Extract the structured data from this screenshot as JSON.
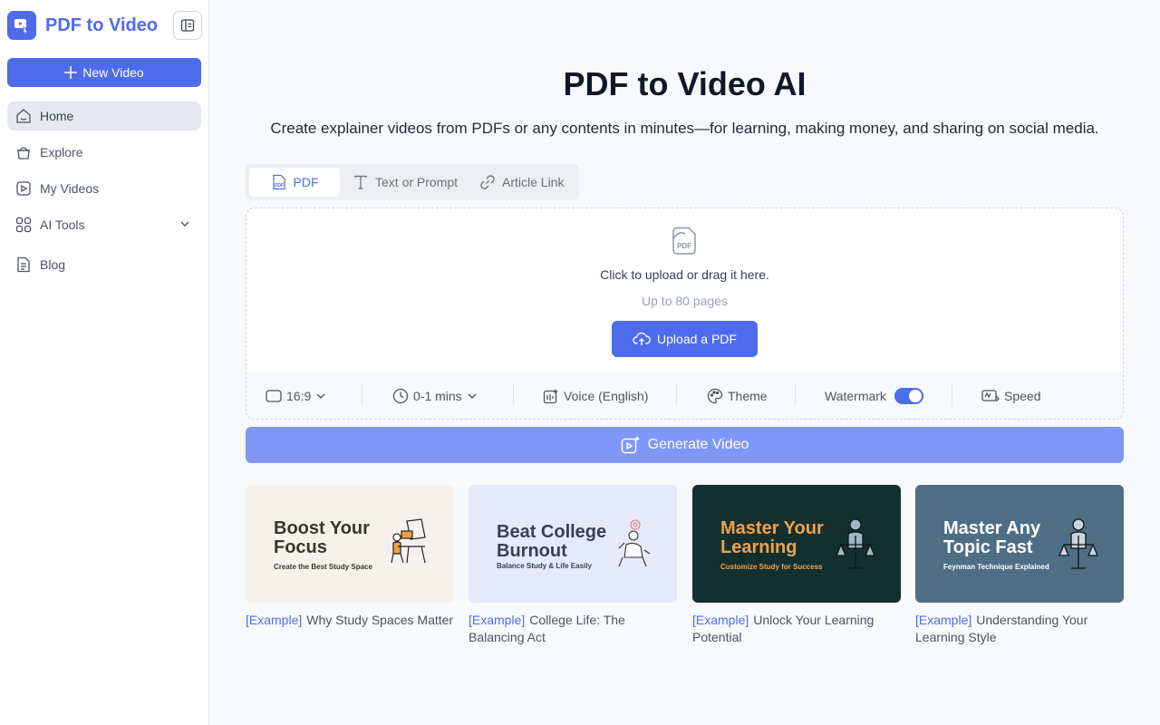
{
  "app": {
    "name": "PDF to Video",
    "brand_color": "#4f6bed"
  },
  "sidebar": {
    "new_video_label": "New Video",
    "items": [
      {
        "label": "Home",
        "icon": "home-icon",
        "active": true
      },
      {
        "label": "Explore",
        "icon": "explore-icon"
      },
      {
        "label": "My Videos",
        "icon": "video-icon"
      },
      {
        "label": "AI Tools",
        "icon": "grid-icon",
        "expandable": true
      },
      {
        "label": "Blog",
        "icon": "document-icon"
      }
    ]
  },
  "main": {
    "title": "PDF to Video AI",
    "subtitle": "Create explainer videos from PDFs or any contents in minutes—for learning, making money, and sharing on social media.",
    "tabs": [
      {
        "label": "PDF",
        "icon": "pdf-icon",
        "active": true
      },
      {
        "label": "Text or Prompt",
        "icon": "text-icon"
      },
      {
        "label": "Article Link",
        "icon": "link-icon"
      }
    ],
    "upload": {
      "text": "Click to upload or drag it here.",
      "sub": "Up to 80 pages",
      "button_label": "Upload a PDF"
    },
    "options": {
      "aspect": "16:9",
      "duration": "0-1 mins",
      "voice": "Voice (English)",
      "theme": "Theme",
      "watermark": "Watermark",
      "watermark_on": true,
      "speed": "Speed"
    },
    "generate_label": "Generate Video",
    "examples": [
      {
        "tag": "[Example]",
        "title": "Why Study Spaces Matter",
        "thumb_title": "Boost Your Focus",
        "thumb_sub": "Create the Best Study Space",
        "bg": "#f5f2ee",
        "fg": "#3a342f",
        "sub_color": "#3a342f"
      },
      {
        "tag": "[Example]",
        "title": "College Life: The Balancing Act",
        "thumb_title": "Beat College Burnout",
        "thumb_sub": "Balance Study & Life Easily",
        "bg": "#e7eafb",
        "fg": "#3a3f55",
        "sub_color": "#3a3f55"
      },
      {
        "tag": "[Example]",
        "title": "Unlock Your Learning Potential",
        "thumb_title": "Master Your Learning",
        "thumb_sub": "Customize Study for Success",
        "bg": "#13302e",
        "fg": "#f0a14a",
        "sub_color": "#f0a14a"
      },
      {
        "tag": "[Example]",
        "title": "Understanding Your Learning Style",
        "thumb_title": "Master Any Topic Fast",
        "thumb_sub": "Feynman Technique Explained",
        "bg": "#4e6e86",
        "fg": "#ffffff",
        "sub_color": "#ffffff"
      }
    ]
  }
}
